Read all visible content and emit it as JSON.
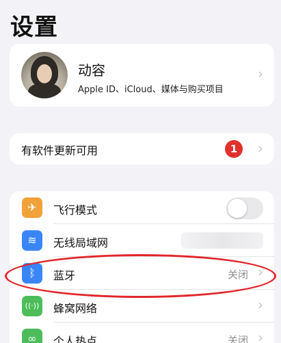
{
  "page": {
    "title": "设置"
  },
  "profile": {
    "name": "动容",
    "subtitle": "Apple ID、iCloud、媒体与购买项目",
    "chevron": "›"
  },
  "update": {
    "label": "有软件更新可用",
    "badge": "1",
    "chevron": "›"
  },
  "settings": {
    "airplane": {
      "label": "飞行模式",
      "icon": "airplane-icon",
      "icon_glyph": "✈",
      "color": "#f0a23b",
      "toggle_on": false
    },
    "wifi": {
      "label": "无线局域网",
      "icon": "wifi-icon",
      "icon_glyph": "≋",
      "color": "#3a86f7"
    },
    "bluetooth": {
      "label": "蓝牙",
      "value": "关闭",
      "icon": "bluetooth-icon",
      "icon_glyph": "ᛒ",
      "color": "#3a86f7",
      "chevron": "›"
    },
    "cellular": {
      "label": "蜂窝网络",
      "icon": "cellular-icon",
      "icon_glyph": "((·))",
      "color": "#4cbd5a",
      "chevron": "›"
    },
    "hotspot": {
      "label": "个人热点",
      "value": "关闭",
      "icon": "hotspot-icon",
      "icon_glyph": "∞",
      "color": "#4cbd5a",
      "chevron": "›"
    }
  },
  "annotation": {
    "highlight_color": "#e2262b"
  }
}
